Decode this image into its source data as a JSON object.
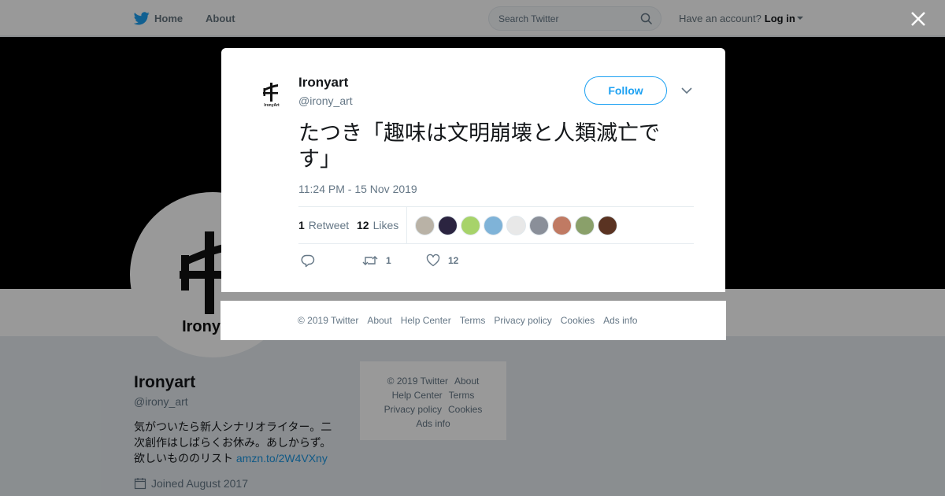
{
  "nav": {
    "home_label": "Home",
    "about_label": "About",
    "search_placeholder": "Search Twitter",
    "have_account": "Have an account?",
    "login_label": "Log in"
  },
  "profile": {
    "name": "Ironyart",
    "handle": "@irony_art",
    "bio": "気がついたら新人シナリオライター。二次創作はしばらくお休み。あしからず。欲しいもののリスト ",
    "bio_link": "amzn.to/2W4VXny",
    "joined": "Joined August 2017"
  },
  "side_footer": {
    "copyright": "© 2019 Twitter",
    "about": "About",
    "help": "Help Center",
    "terms": "Terms",
    "privacy": "Privacy policy",
    "cookies": "Cookies",
    "ads": "Ads info"
  },
  "tweet": {
    "author_name": "Ironyart",
    "author_handle": "@irony_art",
    "follow_label": "Follow",
    "text": "たつき「趣味は文明崩壊と人類滅亡です」",
    "timestamp": "11:24 PM - 15 Nov 2019",
    "retweet_count": "1",
    "retweet_label": "Retweet",
    "like_count": "12",
    "like_label": "Likes",
    "likers": [
      {
        "color": "#b9b2a6"
      },
      {
        "color": "#2b2440"
      },
      {
        "color": "#a7d36a"
      },
      {
        "color": "#7fb3d8"
      },
      {
        "color": "#e8e8e8"
      },
      {
        "color": "#8a8f99"
      },
      {
        "color": "#c07a63"
      },
      {
        "color": "#8aa06a"
      },
      {
        "color": "#5a3322"
      }
    ],
    "actions": {
      "retweet_count": "1",
      "like_count": "12"
    }
  },
  "modal_footer": {
    "copyright": "© 2019 Twitter",
    "about": "About",
    "help": "Help Center",
    "terms": "Terms",
    "privacy": "Privacy policy",
    "cookies": "Cookies",
    "ads": "Ads info"
  },
  "colors": {
    "accent": "#1da1f2",
    "link": "#1b95e0",
    "secondary_text": "#657786"
  }
}
